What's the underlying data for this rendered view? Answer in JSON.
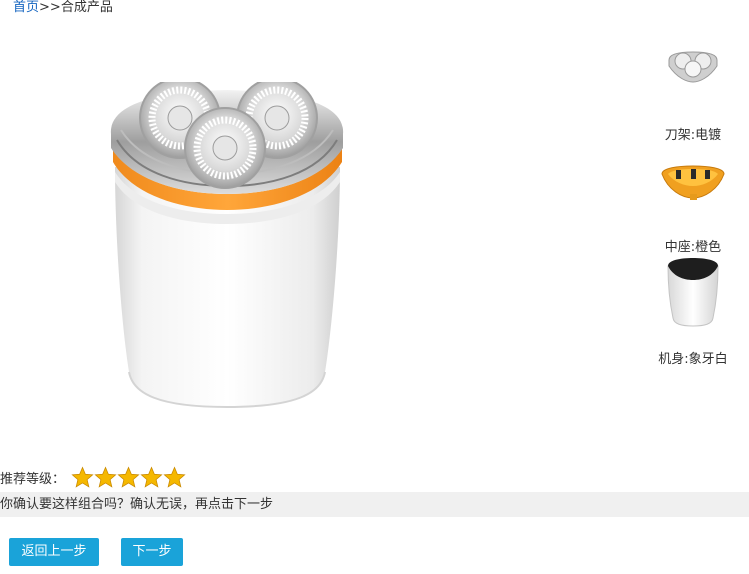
{
  "breadcrumb": {
    "home": "首页",
    "separator": ">>",
    "current": "合成产品"
  },
  "product": {
    "image_icon": "shaver-product-image"
  },
  "parts": [
    {
      "label": "刀架:电镀",
      "icon": "blade-holder-chrome-thumbnail"
    },
    {
      "label": "中座:橙色",
      "icon": "middle-base-orange-thumbnail"
    },
    {
      "label": "机身:象牙白",
      "icon": "body-ivory-thumbnail"
    }
  ],
  "rating": {
    "label": "推荐等级：",
    "stars": 5,
    "max_stars": 5,
    "color": "#f5b800"
  },
  "confirm": {
    "text": "你确认要这样组合吗？确认无误，再点击下一步"
  },
  "buttons": {
    "back_label": "返回上一步",
    "next_label": "下一步",
    "color": "#1aa3d9"
  }
}
